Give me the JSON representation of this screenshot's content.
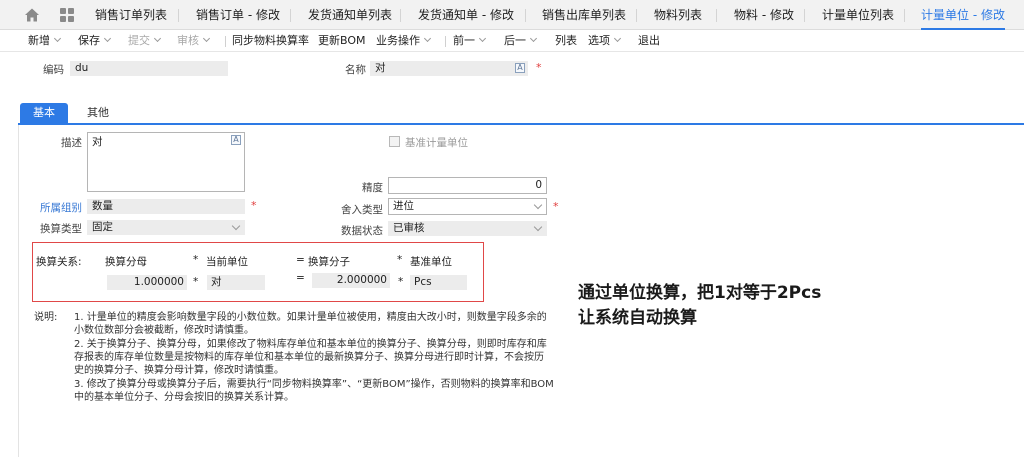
{
  "tabs": [
    "销售订单列表",
    "销售订单 - 修改",
    "发货通知单列表",
    "发货通知单 - 修改",
    "销售出库单列表",
    "物料列表",
    "物料 - 修改",
    "计量单位列表",
    "计量单位 - 修改"
  ],
  "active_tab_index": 8,
  "toolbar": {
    "new": "新增",
    "save": "保存",
    "submit": "提交",
    "audit": "审核",
    "sync": "同步物料换算率",
    "update_bom": "更新BOM",
    "business": "业务操作",
    "prev": "前一",
    "next": "后一",
    "list": "列表",
    "options": "选项",
    "exit": "退出"
  },
  "header": {
    "code_label": "编码",
    "code_value": "du",
    "name_label": "名称",
    "name_value": "对"
  },
  "subtabs": {
    "basic": "基本",
    "other": "其他"
  },
  "form": {
    "desc_label": "描述",
    "desc_value": "对",
    "base_unit_label": "基准计量单位",
    "precision_label": "精度",
    "precision_value": "0",
    "group_label": "所属组别",
    "group_value": "数量",
    "rounding_label": "舍入类型",
    "rounding_value": "进位",
    "conv_type_label": "换算类型",
    "conv_type_value": "固定",
    "status_label": "数据状态",
    "status_value": "已审核"
  },
  "conversion": {
    "label": "换算关系:",
    "denominator_label": "换算分母",
    "current_unit_label": "当前单位",
    "numerator_label": "换算分子",
    "base_unit_label": "基准单位",
    "times": "*",
    "equals": "=",
    "denominator_value": "1.000000",
    "current_unit_value": "对",
    "numerator_value": "2.000000",
    "base_unit_value": "Pcs"
  },
  "notes": {
    "title": "说明:",
    "n1a": "1. 计量单位的精度会影响数量字段的小数位数。如果计量单位被使用，精度由大改小时，则数量字段多余的",
    "n1b": "小数位数部分会被截断，修改时请慎重。",
    "n2a": "2. 关于换算分子、换算分母，如果修改了物料库存单位和基本单位的换算分子、换算分母，则即时库存和库",
    "n2b": "存报表的库存单位数量是按物料的库存单位和基本单位的最新换算分子、换算分母进行即时计算，不会按历",
    "n2c": "史的换算分子、换算分母计算，修改时请慎重。",
    "n3a": "3. 修改了换算分母或换算分子后，需要执行“同步物料换算率”、“更新BOM”操作，否则物料的换算率和BOM",
    "n3b": "中的基本单位分子、分母会按旧的换算关系计算。"
  },
  "callout": {
    "line1": "通过单位换算，把1对等于2Pcs",
    "line2": "让系统自动换算"
  },
  "colors": {
    "accent": "#2d7ae5",
    "required": "#e03c3c",
    "highlight_box": "#e04848"
  }
}
